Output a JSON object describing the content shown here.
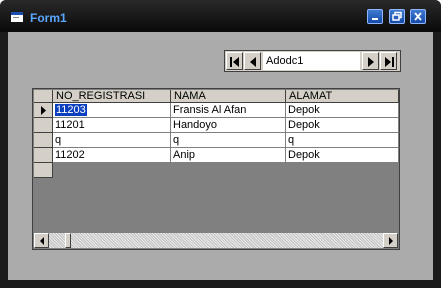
{
  "window": {
    "title": "Form1"
  },
  "adodc": {
    "caption": "Adodc1"
  },
  "grid": {
    "columns": [
      "NO_REGISTRASI",
      "NAMA",
      "ALAMAT"
    ],
    "rows": [
      [
        "11203",
        "Fransis Al Afan",
        "Depok"
      ],
      [
        "11201",
        "Handoyo",
        "Depok"
      ],
      [
        "q",
        "q",
        "q"
      ],
      [
        "11202",
        "Anip",
        "Depok"
      ]
    ]
  },
  "colors": {
    "title_text": "#5aa7ff",
    "title_buttons": "#2563c8",
    "form_background": "#ababab",
    "selection": "#0a3fbf"
  }
}
